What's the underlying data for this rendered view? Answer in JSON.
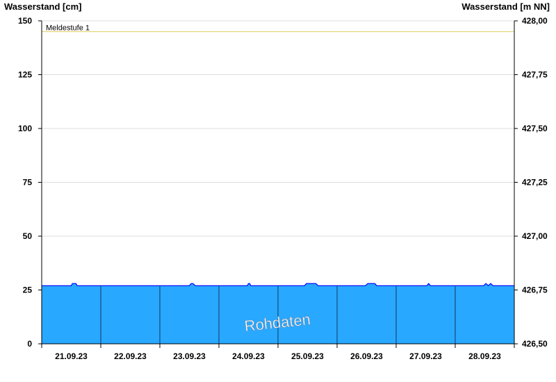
{
  "chart_data": {
    "type": "area",
    "left_axis_title": "Wasserstand [cm]",
    "right_axis_title": "Wasserstand [m NN]",
    "ylim": [
      0,
      150
    ],
    "yticks": [
      0,
      25,
      50,
      75,
      100,
      125,
      150
    ],
    "right_ylim": [
      426.5,
      428.0
    ],
    "right_yticks": [
      "426,50",
      "426,75",
      "427,00",
      "427,25",
      "427,50",
      "427,75",
      "428,00"
    ],
    "x_days": [
      "21.09.23",
      "22.09.23",
      "23.09.23",
      "24.09.23",
      "25.09.23",
      "26.09.23",
      "27.09.23",
      "28.09.23"
    ],
    "xlim_days": [
      0,
      8
    ],
    "series": [
      {
        "x": [
          0,
          0.5,
          0.52,
          0.55,
          0.58,
          0.6,
          2.5,
          2.53,
          2.56,
          2.6,
          3.48,
          3.5,
          3.52,
          3.54,
          4.45,
          4.48,
          4.52,
          4.6,
          4.64,
          4.68,
          5.48,
          5.52,
          5.6,
          5.64,
          5.67,
          5.7,
          6.52,
          6.55,
          6.58,
          7.48,
          7.52,
          7.56,
          7.6,
          7.64,
          8.0
        ],
        "y": [
          27,
          27,
          28,
          28,
          28,
          27,
          27,
          28,
          28,
          27,
          27,
          28,
          28,
          27,
          27,
          28,
          28,
          28,
          28,
          27,
          27,
          28,
          28,
          28,
          27,
          27,
          27,
          28,
          27,
          27,
          28,
          27,
          28,
          27,
          27
        ]
      }
    ],
    "annotations": [
      {
        "label": "Meldestufe 1",
        "y": 145
      }
    ],
    "watermark": "Rohdaten",
    "grid": true,
    "colors": {
      "fill": "#29a8ff",
      "line": "#0000ff",
      "threshold": "#e8d47a",
      "grid": "#dddddd",
      "divider": "#0d3a63"
    }
  }
}
